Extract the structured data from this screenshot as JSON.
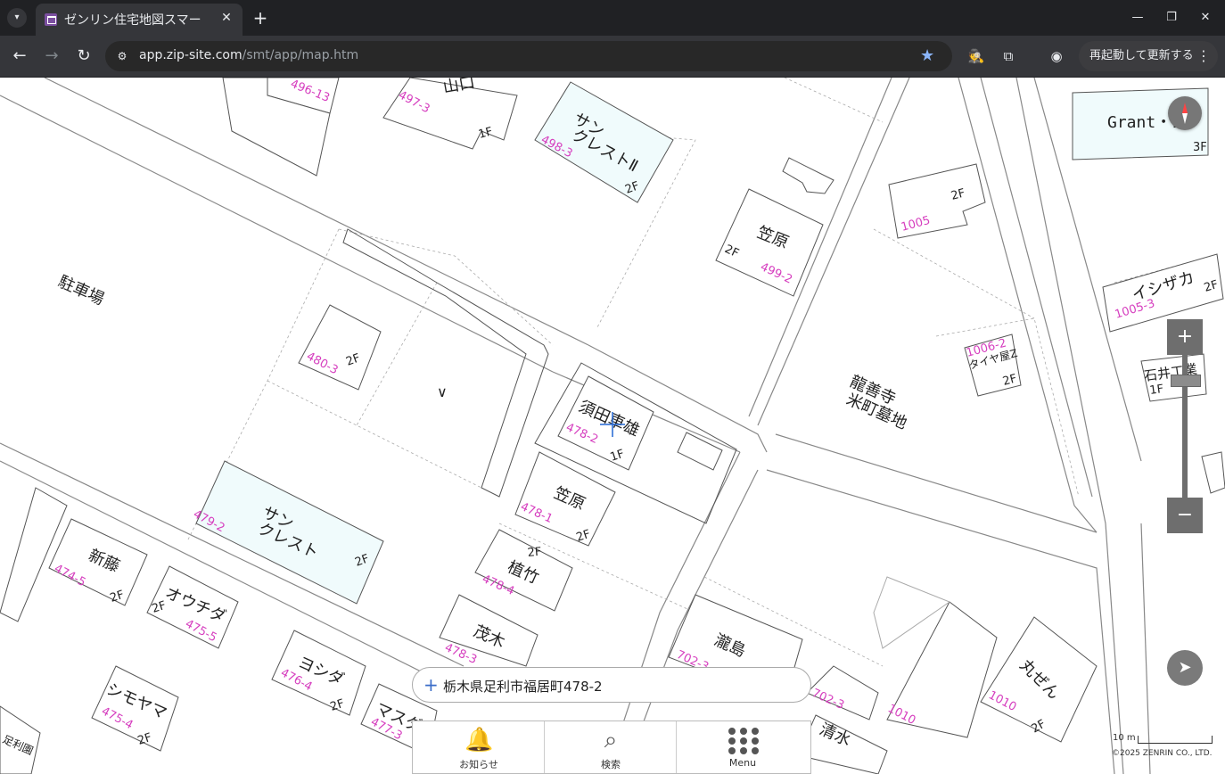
{
  "browser": {
    "tab_title": "ゼンリン住宅地図スマー",
    "url_domain": "app.zip-site.com",
    "url_path": "/smt/app/map.htm",
    "relaunch_label": "再起動して更新する"
  },
  "map": {
    "labels": {
      "parking": "駐車場",
      "temple_1": "龍善寺",
      "temple_2": "米町墓地",
      "grant": "Grant・1",
      "grant_floor": "3F",
      "yamaguchi": "山口",
      "yamaguchi_floor": "1F",
      "sancrest2_1": "サン",
      "sancrest2_2": "クレストⅡ",
      "sancrest2_floor": "2F",
      "kasahara_a": "笠原",
      "kasahara_a_floor": "2F",
      "b1005_floor": "2F",
      "ishizaka": "イシザカ",
      "ishizaka_floor": "2F",
      "tire_shop": "タイヤ屋Z",
      "tire_floor": "2F",
      "ishii": "石井工業",
      "ishii_floor": "1F",
      "b480_floor": "2F",
      "suda": "須田車雄",
      "suda_floor": "1F",
      "kasahara_b": "笠原",
      "kasahara_b_floor": "2F",
      "uetake": "植竹",
      "uetake_floor": "2F",
      "motegi": "茂木",
      "sancrest_1": "サン",
      "sancrest_2": "クレスト",
      "sancrest_floor": "2F",
      "shinto": "新藤",
      "shinto_floor": "2F",
      "ouchida": "オウチダ",
      "ouchida_floor": "2F",
      "yoshida": "ヨシダ",
      "yoshida_floor": "2F",
      "shimoyama": "シモヤマ",
      "shimoyama_floor": "2F",
      "masuda": "マスダ",
      "takishima": "瀧島",
      "shimizu": "清水",
      "maruzen": "丸ぜん",
      "maruzen_floor": "2F",
      "ashikaga": "足利園",
      "p496_13": "496-13",
      "p497_3": "497-3",
      "p498_3": "498-3",
      "p499_2": "499-2",
      "p1005": "1005",
      "p1005_3": "1005-3",
      "p1006_2": "1006-2",
      "p480_3": "480-3",
      "p478_2": "478-2",
      "p478_1": "478-1",
      "p478_4": "478-4",
      "p478_3": "478-3",
      "p479_2": "479-2",
      "p474_5": "474-5",
      "p475_5": "475-5",
      "p476_4": "476-4",
      "p475_4": "475-4",
      "p477_3": "477-3",
      "p702_3": "702-3",
      "p1010a": "1010",
      "p1010b": "1010"
    },
    "scale_label": "10 m",
    "copyright": "©2025 ZENRIN CO., LTD.",
    "address": "栃木県足利市福居町478-2"
  },
  "bottom_nav": {
    "notice": "お知らせ",
    "search": "検索",
    "menu": "Menu"
  },
  "icons": {
    "compass": "compass-icon",
    "locate": "navigation-arrow-icon",
    "bell": "bell-icon",
    "search": "magnifier-icon",
    "menu": "grid-dots-icon"
  }
}
